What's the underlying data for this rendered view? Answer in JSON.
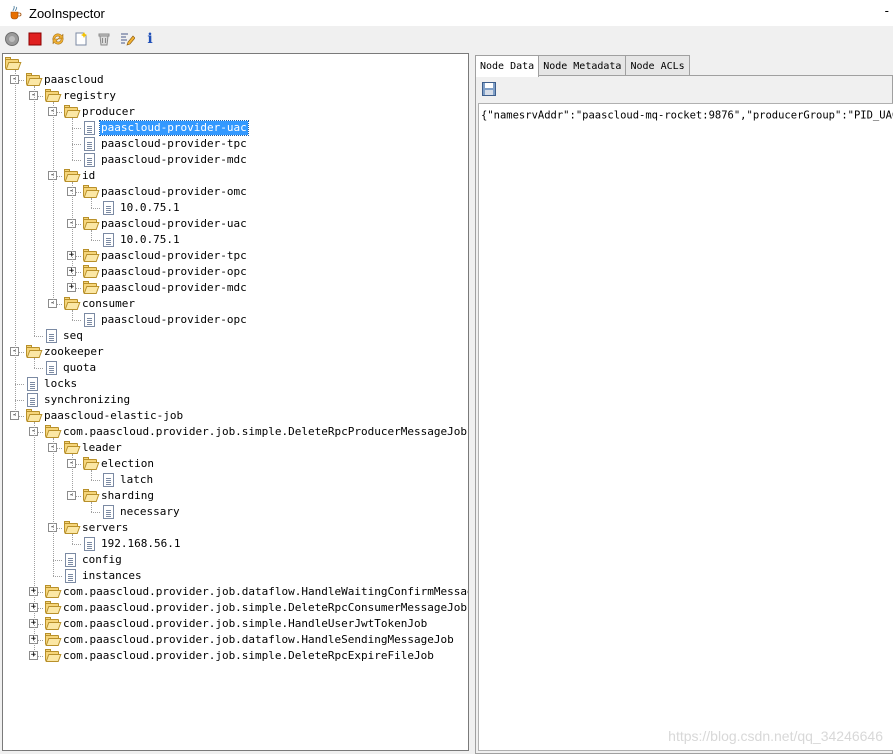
{
  "window": {
    "title": "ZooInspector",
    "minimize": "-"
  },
  "toolbar": {
    "buttons": [
      {
        "name": "connect",
        "icon": "connect-icon"
      },
      {
        "name": "disconnect",
        "icon": "stop-icon"
      },
      {
        "name": "refresh",
        "icon": "refresh-icon"
      },
      {
        "name": "add-node",
        "icon": "new-node-icon"
      },
      {
        "name": "delete-node",
        "icon": "trash-icon"
      },
      {
        "name": "edit-node-viewers",
        "icon": "edit-viewers-icon"
      },
      {
        "name": "about",
        "icon": "info-icon",
        "label": "i"
      }
    ]
  },
  "tree": {
    "nodes": [
      {
        "label": "",
        "depth": 0,
        "type": "folder",
        "toggle": ""
      },
      {
        "label": "paascloud",
        "depth": 0,
        "type": "folder",
        "toggle": "-"
      },
      {
        "label": "registry",
        "depth": 1,
        "type": "folder",
        "toggle": "-"
      },
      {
        "label": "producer",
        "depth": 2,
        "type": "folder",
        "toggle": "-"
      },
      {
        "label": "paascloud-provider-uac",
        "depth": 3,
        "type": "file",
        "toggle": "",
        "selected": true
      },
      {
        "label": "paascloud-provider-tpc",
        "depth": 3,
        "type": "file",
        "toggle": ""
      },
      {
        "label": "paascloud-provider-mdc",
        "depth": 3,
        "type": "file",
        "toggle": ""
      },
      {
        "label": "id",
        "depth": 2,
        "type": "folder",
        "toggle": "-"
      },
      {
        "label": "paascloud-provider-omc",
        "depth": 3,
        "type": "folder",
        "toggle": "-"
      },
      {
        "label": "10.0.75.1",
        "depth": 4,
        "type": "file",
        "toggle": ""
      },
      {
        "label": "paascloud-provider-uac",
        "depth": 3,
        "type": "folder",
        "toggle": "-"
      },
      {
        "label": "10.0.75.1",
        "depth": 4,
        "type": "file",
        "toggle": ""
      },
      {
        "label": "paascloud-provider-tpc",
        "depth": 3,
        "type": "folder",
        "toggle": "+"
      },
      {
        "label": "paascloud-provider-opc",
        "depth": 3,
        "type": "folder",
        "toggle": "+"
      },
      {
        "label": "paascloud-provider-mdc",
        "depth": 3,
        "type": "folder",
        "toggle": "+"
      },
      {
        "label": "consumer",
        "depth": 2,
        "type": "folder",
        "toggle": "-"
      },
      {
        "label": "paascloud-provider-opc",
        "depth": 3,
        "type": "file",
        "toggle": ""
      },
      {
        "label": "seq",
        "depth": 1,
        "type": "file",
        "toggle": ""
      },
      {
        "label": "zookeeper",
        "depth": 0,
        "type": "folder",
        "toggle": "-"
      },
      {
        "label": "quota",
        "depth": 1,
        "type": "file",
        "toggle": ""
      },
      {
        "label": "locks",
        "depth": 0,
        "type": "file",
        "toggle": ""
      },
      {
        "label": "synchronizing",
        "depth": 0,
        "type": "file",
        "toggle": ""
      },
      {
        "label": "paascloud-elastic-job",
        "depth": 0,
        "type": "folder",
        "toggle": "-"
      },
      {
        "label": "com.paascloud.provider.job.simple.DeleteRpcProducerMessageJob",
        "depth": 1,
        "type": "folder",
        "toggle": "-"
      },
      {
        "label": "leader",
        "depth": 2,
        "type": "folder",
        "toggle": "-"
      },
      {
        "label": "election",
        "depth": 3,
        "type": "folder",
        "toggle": "-"
      },
      {
        "label": "latch",
        "depth": 4,
        "type": "file",
        "toggle": ""
      },
      {
        "label": "sharding",
        "depth": 3,
        "type": "folder",
        "toggle": "-"
      },
      {
        "label": "necessary",
        "depth": 4,
        "type": "file",
        "toggle": ""
      },
      {
        "label": "servers",
        "depth": 2,
        "type": "folder",
        "toggle": "-"
      },
      {
        "label": "192.168.56.1",
        "depth": 3,
        "type": "file",
        "toggle": ""
      },
      {
        "label": "config",
        "depth": 2,
        "type": "file",
        "toggle": ""
      },
      {
        "label": "instances",
        "depth": 2,
        "type": "file",
        "toggle": ""
      },
      {
        "label": "com.paascloud.provider.job.dataflow.HandleWaitingConfirmMessageJob",
        "depth": 1,
        "type": "folder",
        "toggle": "+"
      },
      {
        "label": "com.paascloud.provider.job.simple.DeleteRpcConsumerMessageJob",
        "depth": 1,
        "type": "folder",
        "toggle": "+"
      },
      {
        "label": "com.paascloud.provider.job.simple.HandleUserJwtTokenJob",
        "depth": 1,
        "type": "folder",
        "toggle": "+"
      },
      {
        "label": "com.paascloud.provider.job.dataflow.HandleSendingMessageJob",
        "depth": 1,
        "type": "folder",
        "toggle": "+"
      },
      {
        "label": "com.paascloud.provider.job.simple.DeleteRpcExpireFileJob",
        "depth": 1,
        "type": "folder",
        "toggle": "+"
      }
    ]
  },
  "tabs": [
    {
      "label": "Node Data",
      "active": true
    },
    {
      "label": "Node Metadata",
      "active": false
    },
    {
      "label": "Node ACLs",
      "active": false
    }
  ],
  "node_data": {
    "save_icon": "save-icon",
    "content": "{\"namesrvAddr\":\"paascloud-mq-rocket:9876\",\"producerGroup\":\"PID_UAC\"}"
  },
  "watermark": "https://blog.csdn.net/qq_34246646",
  "colors": {
    "selection": "#3399ff",
    "folder": "#f6d57a",
    "stop": "#e02020",
    "info": "#1f4fb8"
  }
}
